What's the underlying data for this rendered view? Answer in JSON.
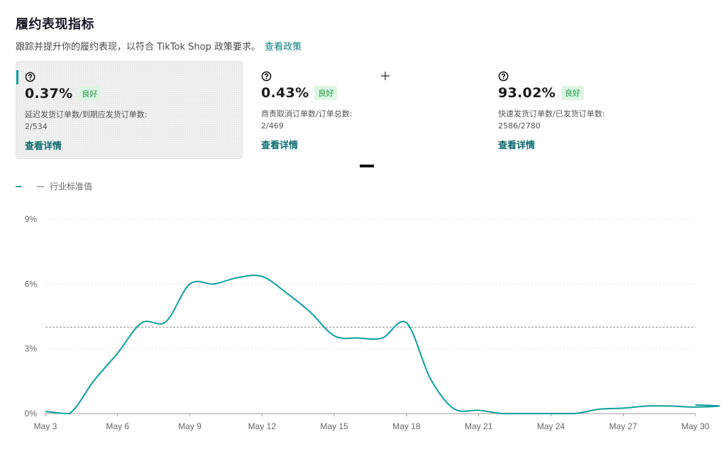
{
  "header": {
    "title": "履约表现指标",
    "subtitle": "跟踪并提升你的履约表现，以符合 TikTok Shop 政策要求。",
    "policy_link": "查看政策"
  },
  "cards": [
    {
      "value": "0.37%",
      "badge": "良好",
      "label": "延迟发货订单数/到期应发货订单数:",
      "fraction": "2/534",
      "link": "查看详情",
      "selected": true,
      "icon": "help-circle-icon"
    },
    {
      "value": "0.43%",
      "badge": "良好",
      "label": "商责取消订单数/订单总数:",
      "fraction": "2/469",
      "link": "查看详情",
      "selected": false,
      "icon": "help-circle-icon"
    },
    {
      "value": "93.02%",
      "badge": "良好",
      "label": "快速发货订单数/已发货订单数:",
      "fraction": "2586/2780",
      "link": "查看详情",
      "selected": false,
      "icon": "help-circle-icon"
    }
  ],
  "legend": {
    "standard_label": "行业标准值"
  },
  "colors": {
    "accent": "#0e9f9a",
    "badge_text": "#1a9b46",
    "badge_bg": "#ddf5e3",
    "standard_line": "#b0b0b0"
  },
  "chart_data": {
    "type": "line",
    "x_ticks": [
      "May 3",
      "May 6",
      "May 9",
      "May 12",
      "May 15",
      "May 18",
      "May 21",
      "May 24",
      "May 27",
      "May 30"
    ],
    "y_ticks": [
      "0%",
      "3%",
      "6%",
      "9%"
    ],
    "ylim": [
      0,
      9
    ],
    "xlim": [
      "May 3",
      "Jun 1"
    ],
    "grid": true,
    "series": [
      {
        "x": [
          "May 3",
          "May 4",
          "May 5",
          "May 6",
          "May 7",
          "May 8",
          "May 9",
          "May 10",
          "May 11",
          "May 12",
          "May 13",
          "May 14",
          "May 15",
          "May 16",
          "May 17",
          "May 18",
          "May 19",
          "May 20",
          "May 21",
          "May 22",
          "May 23",
          "May 24",
          "May 25",
          "May 26",
          "May 27",
          "May 28",
          "May 29",
          "May 30",
          "May 31",
          "Jun 1"
        ],
        "values": [
          0.1,
          0.0,
          1.5,
          2.8,
          4.2,
          4.25,
          6.0,
          6.0,
          6.3,
          6.35,
          5.6,
          4.7,
          3.6,
          3.5,
          3.5,
          4.2,
          1.6,
          0.2,
          0.15,
          0.0,
          0.0,
          0.0,
          0.0,
          0.2,
          0.25,
          0.35,
          0.35,
          0.3,
          0.35,
          0.4
        ]
      }
    ],
    "standard_line": {
      "name": "行业标准值",
      "value": 4.0
    }
  }
}
